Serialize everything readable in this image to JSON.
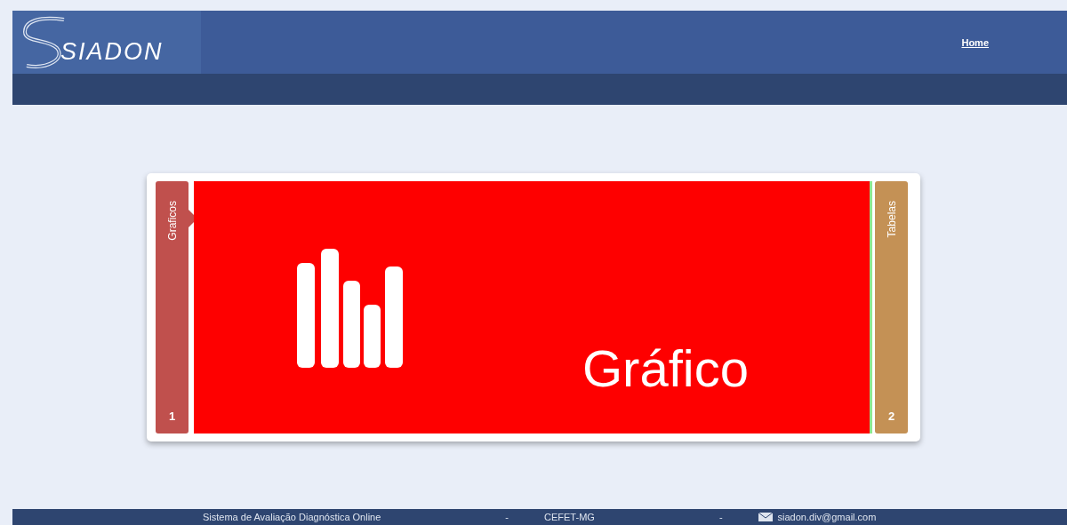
{
  "header": {
    "logo_text": "SIADON",
    "nav": [
      {
        "label": "Home"
      }
    ]
  },
  "slider": {
    "panels": [
      {
        "label": "Graficos",
        "number": "1",
        "selected": true,
        "color": "#c0504d"
      },
      {
        "label": "Tabelas",
        "number": "2",
        "selected": false,
        "color": "#c49155"
      }
    ],
    "slide": {
      "caption": "Gráfico"
    }
  },
  "footer": {
    "items": [
      {
        "kind": "text",
        "text": "Sistema de Avaliação Diagnóstica Online"
      },
      {
        "kind": "separator",
        "text": "-"
      },
      {
        "kind": "text",
        "text": "CEFET-MG"
      },
      {
        "kind": "separator",
        "text": "-"
      },
      {
        "kind": "email",
        "text": "siadon.div@gmail.com"
      }
    ]
  }
}
